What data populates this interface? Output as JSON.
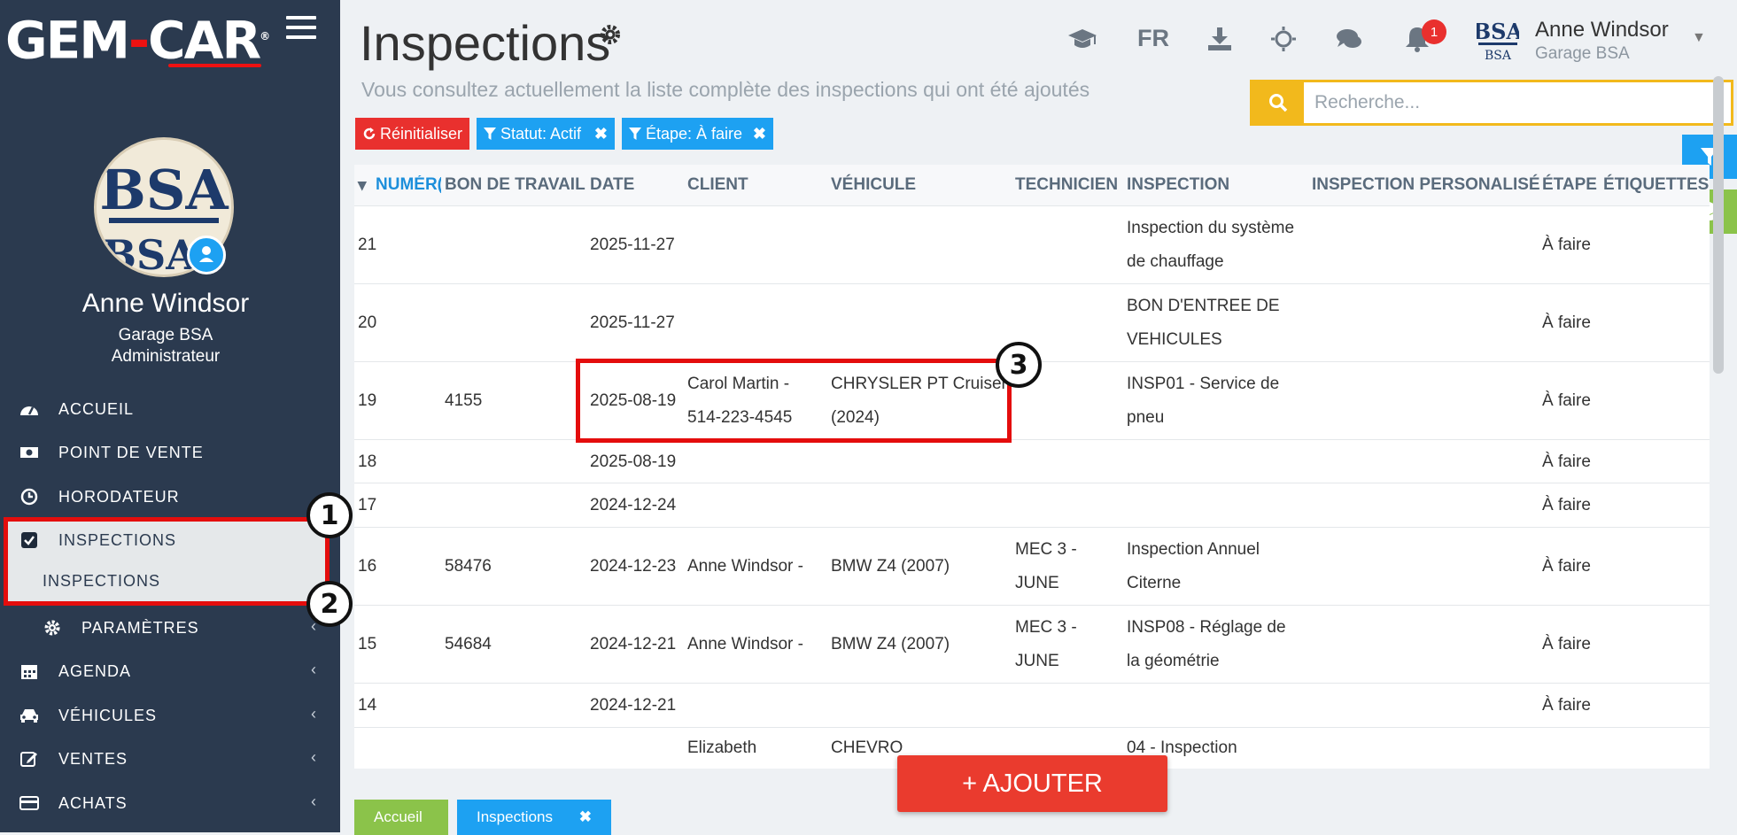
{
  "app": {
    "logo_left": "GEM",
    "logo_dash": "-",
    "logo_right": "CAR",
    "logo_reg": "®"
  },
  "profile": {
    "name": "Anne Windsor",
    "garage": "Garage BSA",
    "role": "Administrateur",
    "avatar_text": "BSA"
  },
  "nav": {
    "accueil": "ACCUEIL",
    "point_de_vente": "POINT DE VENTE",
    "horodateur": "HORODATEUR",
    "inspections": "INSPECTIONS",
    "inspections_sub": "INSPECTIONS",
    "parametres": "PARAMÈTRES",
    "agenda": "AGENDA",
    "vehicules": "VÉHICULES",
    "ventes": "VENTES",
    "achats": "ACHATS",
    "chevron": "‹"
  },
  "page": {
    "title": "Inspections",
    "subtitle": "Vous consultez actuellement la liste complète des inspections qui ont été ajoutés"
  },
  "topbar": {
    "lang": "FR",
    "notif_count": "1",
    "user_name": "Anne Windsor",
    "user_garage": "Garage BSA",
    "logo_small": "BSA"
  },
  "search": {
    "placeholder": "Recherche..."
  },
  "filters": {
    "reset": "Réinitialiser",
    "statut": "Statut: Actif",
    "etape": "Étape: À faire",
    "remove": "✖"
  },
  "table": {
    "headers": {
      "numero": "NUMÉR(",
      "bon": "BON DE TRAVAIL",
      "date": "DATE",
      "client": "CLIENT",
      "vehicule": "VÉHICULE",
      "technicien": "TECHNICIEN",
      "inspection": "INSPECTION",
      "personnalise": "INSPECTION PERSONALISÉ",
      "etape": "ÉTAPE",
      "etiquettes": "ÉTIQUETTES"
    },
    "rows": [
      {
        "num": "21",
        "bon": "",
        "date": "2025-11-27",
        "client1": "",
        "client2": "",
        "veh1": "",
        "veh2": "",
        "tech1": "",
        "tech2": "",
        "insp1": "Inspection du système",
        "insp2": "de chauffage",
        "etape": "À faire"
      },
      {
        "num": "20",
        "bon": "",
        "date": "2025-11-27",
        "client1": "",
        "client2": "",
        "veh1": "",
        "veh2": "",
        "tech1": "",
        "tech2": "",
        "insp1": "BON D'ENTREE DE",
        "insp2": "VEHICULES",
        "etape": "À faire"
      },
      {
        "num": "19",
        "bon": "4155",
        "date": "2025-08-19",
        "client1": "Carol Martin -",
        "client2": "514-223-4545",
        "veh1": "CHRYSLER PT Cruiser",
        "veh2": "(2024)",
        "tech1": "",
        "tech2": "",
        "insp1": "INSP01 - Service de",
        "insp2": "pneu",
        "etape": "À faire"
      },
      {
        "num": "18",
        "bon": "",
        "date": "2025-08-19",
        "client1": "",
        "client2": "",
        "veh1": "",
        "veh2": "",
        "tech1": "",
        "tech2": "",
        "insp1": "",
        "insp2": "",
        "etape": "À faire"
      },
      {
        "num": "17",
        "bon": "",
        "date": "2024-12-24",
        "client1": "",
        "client2": "",
        "veh1": "",
        "veh2": "",
        "tech1": "",
        "tech2": "",
        "insp1": "",
        "insp2": "",
        "etape": "À faire"
      },
      {
        "num": "16",
        "bon": "58476",
        "date": "2024-12-23",
        "client1": "Anne Windsor -",
        "client2": "",
        "veh1": "BMW Z4 (2007)",
        "veh2": "",
        "tech1": "MEC 3 -",
        "tech2": "JUNE",
        "insp1": "Inspection Annuel",
        "insp2": "Citerne",
        "etape": "À faire"
      },
      {
        "num": "15",
        "bon": "54684",
        "date": "2024-12-21",
        "client1": "Anne Windsor -",
        "client2": "",
        "veh1": "BMW Z4 (2007)",
        "veh2": "",
        "tech1": "MEC 3 -",
        "tech2": "JUNE",
        "insp1": "INSP08 - Réglage de",
        "insp2": "la géométrie",
        "etape": "À faire"
      },
      {
        "num": "14",
        "bon": "",
        "date": "2024-12-21",
        "client1": "",
        "client2": "",
        "veh1": "",
        "veh2": "",
        "tech1": "",
        "tech2": "",
        "insp1": "",
        "insp2": "",
        "etape": "À faire"
      },
      {
        "num": "",
        "bon": "",
        "date": "",
        "client1": "Elizabeth",
        "client2": "",
        "veh1": "CHEVRO",
        "veh2": "",
        "tech1": "",
        "tech2": "",
        "insp1": "04 - Inspection",
        "insp2": "",
        "etape": ""
      }
    ]
  },
  "actions": {
    "add": "+ AJOUTER"
  },
  "bottom_tabs": {
    "accueil": "Accueil",
    "inspections": "Inspections",
    "close": "✖"
  },
  "callouts": {
    "one": "1",
    "two": "2",
    "three": "3"
  },
  "colors": {
    "sidebar": "#2b3a4f",
    "accent_blue": "#1da1f2",
    "accent_red": "#e9302e",
    "accent_yellow": "#f2b91c",
    "accent_green": "#8bc34a",
    "annotation_red": "#e40d0d"
  }
}
